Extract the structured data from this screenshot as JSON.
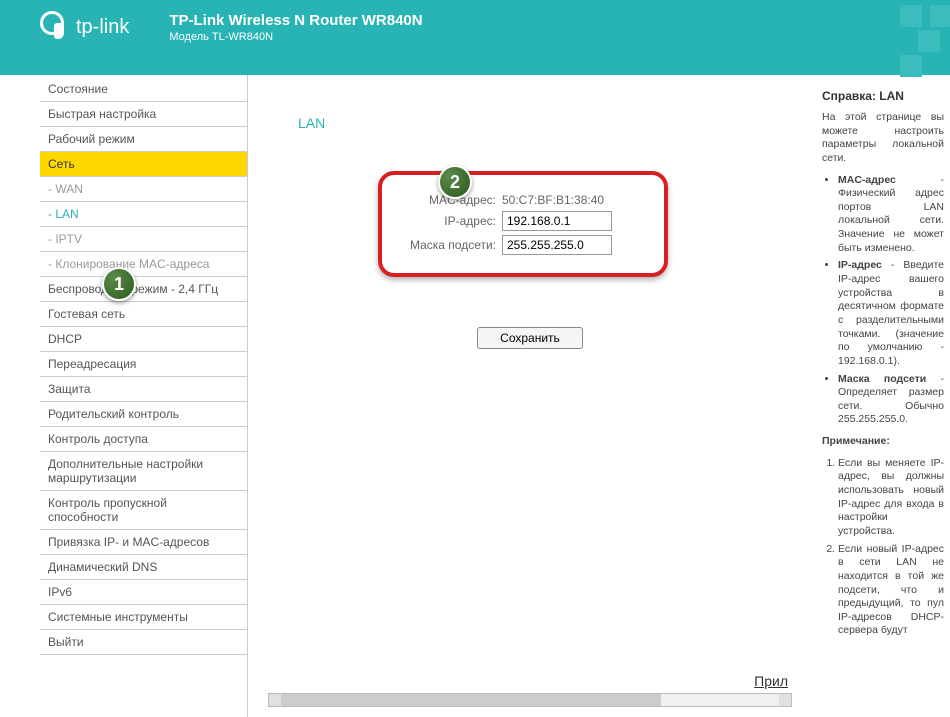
{
  "header": {
    "brand": "tp-link",
    "title": "TP-Link Wireless N Router WR840N",
    "model": "Модель TL-WR840N"
  },
  "sidebar": {
    "items": [
      {
        "label": "Состояние",
        "type": "item"
      },
      {
        "label": "Быстрая настройка",
        "type": "item"
      },
      {
        "label": "Рабочий режим",
        "type": "item"
      },
      {
        "label": "Сеть",
        "type": "item",
        "active": true
      },
      {
        "label": "- WAN",
        "type": "sub"
      },
      {
        "label": "- LAN",
        "type": "sub",
        "selected": true
      },
      {
        "label": "- IPTV",
        "type": "sub"
      },
      {
        "label": "- Клонирование MAC-адреса",
        "type": "sub"
      },
      {
        "label": "Беспроводной режим - 2,4 ГГц",
        "type": "item"
      },
      {
        "label": "Гостевая сеть",
        "type": "item"
      },
      {
        "label": "DHCP",
        "type": "item"
      },
      {
        "label": "Переадресация",
        "type": "item"
      },
      {
        "label": "Защита",
        "type": "item"
      },
      {
        "label": "Родительский контроль",
        "type": "item"
      },
      {
        "label": "Контроль доступа",
        "type": "item"
      },
      {
        "label": "Дополнительные настройки маршрутизации",
        "type": "item"
      },
      {
        "label": "Контроль пропускной способности",
        "type": "item"
      },
      {
        "label": "Привязка IP- и MAC-адресов",
        "type": "item"
      },
      {
        "label": "Динамический DNS",
        "type": "item"
      },
      {
        "label": "IPv6",
        "type": "item"
      },
      {
        "label": "Системные инструменты",
        "type": "item"
      },
      {
        "label": "Выйти",
        "type": "item"
      }
    ]
  },
  "main": {
    "title": "LAN",
    "mac_label": "MAC-адрес:",
    "mac_value": "50:C7:BF:B1:38:40",
    "ip_label": "IP-адрес:",
    "ip_value": "192.168.0.1",
    "mask_label": "Маска подсети:",
    "mask_value": "255.255.255.0",
    "save_label": "Сохранить",
    "status_text": "Прил"
  },
  "badges": {
    "b1": "1",
    "b2": "2"
  },
  "help": {
    "title": "Справка: LAN",
    "intro": "На этой странице вы можете настроить параметры локальной сети.",
    "li1_b": "MAC-адрес",
    "li1_t": " - Физический адрес портов LAN локальной сети. Значение не может быть изменено.",
    "li2_b": "IP-адрес",
    "li2_t": " - Введите IP-адрес вашего устройства в десятичном формате с разделительными точками. (значение по умолчанию - 192.168.0.1).",
    "li3_b": "Маска подсети",
    "li3_t": " - Определяет размер сети. Обычно 255.255.255.0.",
    "note_title": "Примечание:",
    "ol1": "Если вы меняете IP-адрес, вы должны использовать новый IP-адрес для входа в настройки устройства.",
    "ol2": "Если новый IP-адрес в сети LAN не находится в той же подсети, что и предыдущий, то пул IP-адресов DHCP-сервера будут"
  }
}
